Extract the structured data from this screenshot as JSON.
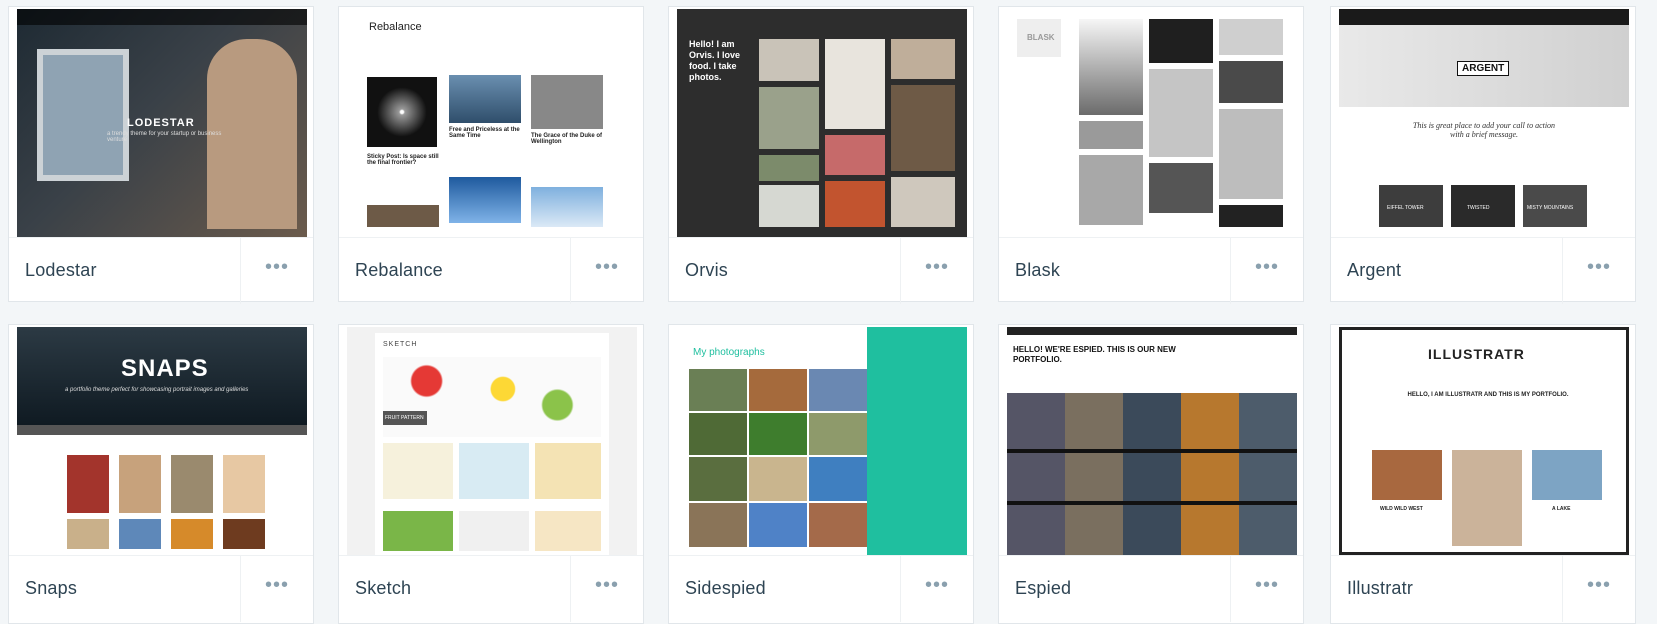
{
  "themes": [
    {
      "name": "Lodestar",
      "more": "•••",
      "tagline": "LODESTAR",
      "sub": "a trendy theme for your startup or business venture"
    },
    {
      "name": "Rebalance",
      "more": "•••",
      "tagline": "Rebalance",
      "post1": "Sticky Post: Is space still the final frontier?",
      "post2": "Free and Priceless at the Same Time",
      "post3": "The Grace of the Duke of Wellington"
    },
    {
      "name": "Orvis",
      "more": "•••",
      "tagline": "Hello! I am Orvis. I love food. I take photos."
    },
    {
      "name": "Blask",
      "more": "•••",
      "tagline": "BLASK"
    },
    {
      "name": "Argent",
      "more": "•••",
      "tagline": "ARGENT",
      "cta": "This is great place to add your call to action with a brief message.",
      "labels": [
        "EIFFEL TOWER",
        "TWISTED",
        "MISTY MOUNTAINS"
      ]
    },
    {
      "name": "Snaps",
      "more": "•••",
      "tagline": "SNAPS",
      "sub": "a portfolio theme perfect for showcasing portrait images and galleries"
    },
    {
      "name": "Sketch",
      "more": "•••",
      "tagline": "SKETCH",
      "badge": "FRUIT PATTERN"
    },
    {
      "name": "Sidespied",
      "more": "•••",
      "tagline": "My photographs"
    },
    {
      "name": "Espied",
      "more": "•••",
      "tagline": "HELLO! WE'RE ESPIED. THIS IS OUR NEW PORTFOLIO."
    },
    {
      "name": "Illustratr",
      "more": "•••",
      "tagline": "ILLUSTRATR",
      "sub": "HELLO, I AM ILLUSTRATR AND THIS IS MY PORTFOLIO.",
      "labels": [
        "WILD WILD WEST",
        "A LAKE"
      ]
    }
  ]
}
